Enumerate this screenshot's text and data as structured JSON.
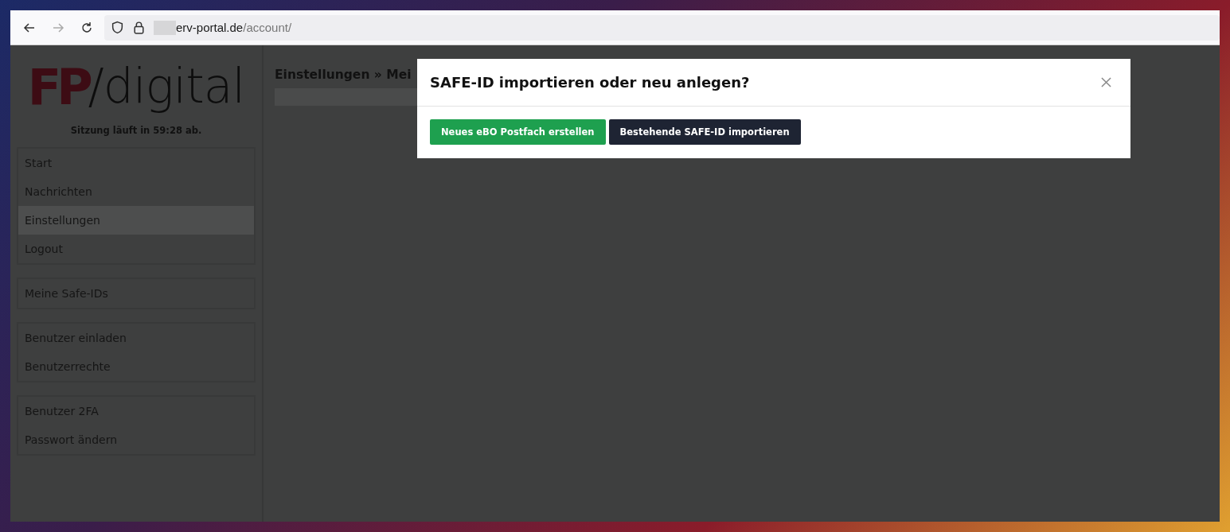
{
  "browser": {
    "url_host": "erv-portal.de",
    "url_path": "/account/"
  },
  "logo": {
    "mark": "FP",
    "word": "/digital"
  },
  "session": "Sitzung läuft in 59:28 ab.",
  "sidebar": {
    "groups": [
      {
        "items": [
          {
            "label": "Start",
            "selected": false
          },
          {
            "label": "Nachrichten",
            "selected": false
          },
          {
            "label": "Einstellungen",
            "selected": true
          },
          {
            "label": "Logout",
            "selected": false
          }
        ]
      },
      {
        "items": [
          {
            "label": "Meine Safe-IDs",
            "selected": false
          }
        ]
      },
      {
        "items": [
          {
            "label": "Benutzer einladen",
            "selected": false
          },
          {
            "label": "Benutzerrechte",
            "selected": false
          }
        ]
      },
      {
        "items": [
          {
            "label": "Benutzer 2FA",
            "selected": false
          },
          {
            "label": "Passwort ändern",
            "selected": false
          }
        ]
      }
    ]
  },
  "page_title": "Einstellungen » Mei",
  "modal": {
    "title": "SAFE-ID importieren oder neu anlegen?",
    "buttons": [
      {
        "label": "Neues eBO Postfach erstellen",
        "kind": "success"
      },
      {
        "label": "Bestehende SAFE-ID importieren",
        "kind": "dark"
      }
    ]
  }
}
